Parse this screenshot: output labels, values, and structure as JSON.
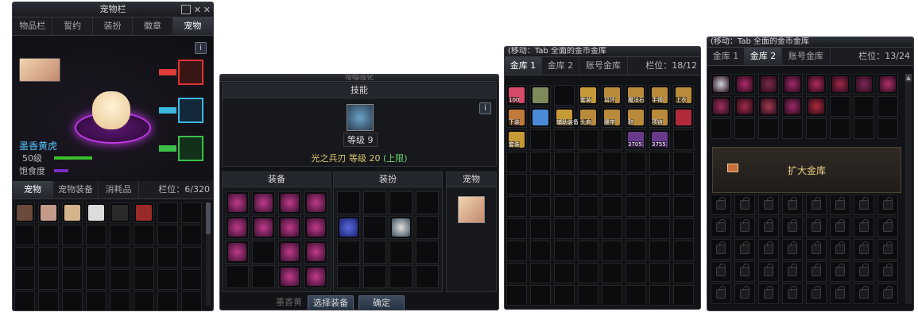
{
  "pet_window": {
    "title": "宠物栏",
    "tabs": [
      "物品栏",
      "誓约",
      "装扮",
      "徽章",
      "宠物"
    ],
    "info_icon": "i",
    "pet_name": "墨香黄虎",
    "level_label": "50级",
    "hunger_label": "饱食度",
    "bottom_tabs": [
      "宠物",
      "宠物装备",
      "消耗品"
    ],
    "slot_label": "栏位：6/320",
    "colors": {
      "level_bar": "#39c02e",
      "hunger_bar": "#7b2cc0",
      "name": "#57c4ff"
    }
  },
  "enhance_window": {
    "title": "增幅强化",
    "skill_header": "技能",
    "skill_level_badge": "等级 9",
    "skill_name": "光之兵刃",
    "skill_level_text": "等级 20",
    "skill_cap": "(上限)",
    "sections": [
      "装备",
      "装扮",
      "宠物"
    ],
    "buttons": [
      "选择装备",
      "确定"
    ],
    "info_icon": "i",
    "bottom_text": "墨香黄"
  },
  "storage1": {
    "title": "(移动：Tab  全面的金币金库",
    "tabs": [
      "金库 1",
      "金库 2",
      "账号金库"
    ],
    "slot_label": "栏位：18/12",
    "items": [
      {
        "text": "100",
        "color": "#d64a6a"
      },
      {
        "text": "",
        "color": "#7f8a5a"
      },
      {
        "text": "",
        "color": "#0d0e10"
      },
      {
        "text": "套装",
        "color": "#c79a38"
      },
      {
        "text": "耳环",
        "color": "#b98a3a"
      },
      {
        "text": "魔法石",
        "color": "#b98a3a"
      },
      {
        "text": "手镯",
        "color": "#b98a3a"
      },
      {
        "text": "上衣",
        "color": "#b98a3a"
      },
      {
        "text": "下装",
        "color": "#c27a3a"
      },
      {
        "text": "",
        "color": "#4a8ad6"
      },
      {
        "text": "辅助装备",
        "color": "#c79a38"
      },
      {
        "text": "头肩",
        "color": "#b98a3a"
      },
      {
        "text": "腰带",
        "color": "#b98a3a"
      },
      {
        "text": "鞋",
        "color": "#b98a3a"
      },
      {
        "text": "项链",
        "color": "#b98a3a"
      },
      {
        "text": "",
        "color": "#b02a3a"
      },
      {
        "text": "套装",
        "color": "#c79a38"
      },
      {
        "text": "",
        "color": "#0d0e10"
      },
      {
        "text": "",
        "color": "#0d0e10"
      },
      {
        "text": "",
        "color": "#0d0e10"
      },
      {
        "text": "",
        "color": "#0d0e10"
      },
      {
        "text": "3705",
        "color": "#6a3a8a"
      },
      {
        "text": "3755",
        "color": "#6a3a8a"
      }
    ]
  },
  "storage2": {
    "title": "(移动：Tab  全面的金币金库",
    "tabs": [
      "金库 1",
      "金库 2",
      "账号金库"
    ],
    "slot_label": "栏位：13/24",
    "expand_label": "扩大金库"
  }
}
